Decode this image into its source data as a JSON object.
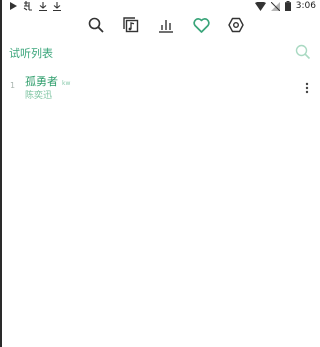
{
  "status_bar": {
    "time": "3:06",
    "left_icons": [
      "play-icon",
      "app-icon",
      "download-icon",
      "download-icon"
    ],
    "right_icons": [
      "wifi-icon",
      "signal-icon",
      "battery-icon"
    ]
  },
  "toolbar": {
    "buttons": [
      "search-icon",
      "music-library-icon",
      "chart-icon",
      "heart-icon",
      "settings-icon"
    ],
    "active": "heart-icon"
  },
  "playlist": {
    "title": "试听列表",
    "search_icon": "search-icon"
  },
  "songs": [
    {
      "index": "1",
      "title": "孤勇者",
      "quality": "kw",
      "artist": "陈奕迅"
    }
  ],
  "colors": {
    "accent": "#3aa57a",
    "title_green": "#2f9e6c",
    "artist_green": "#7cc3a0"
  }
}
